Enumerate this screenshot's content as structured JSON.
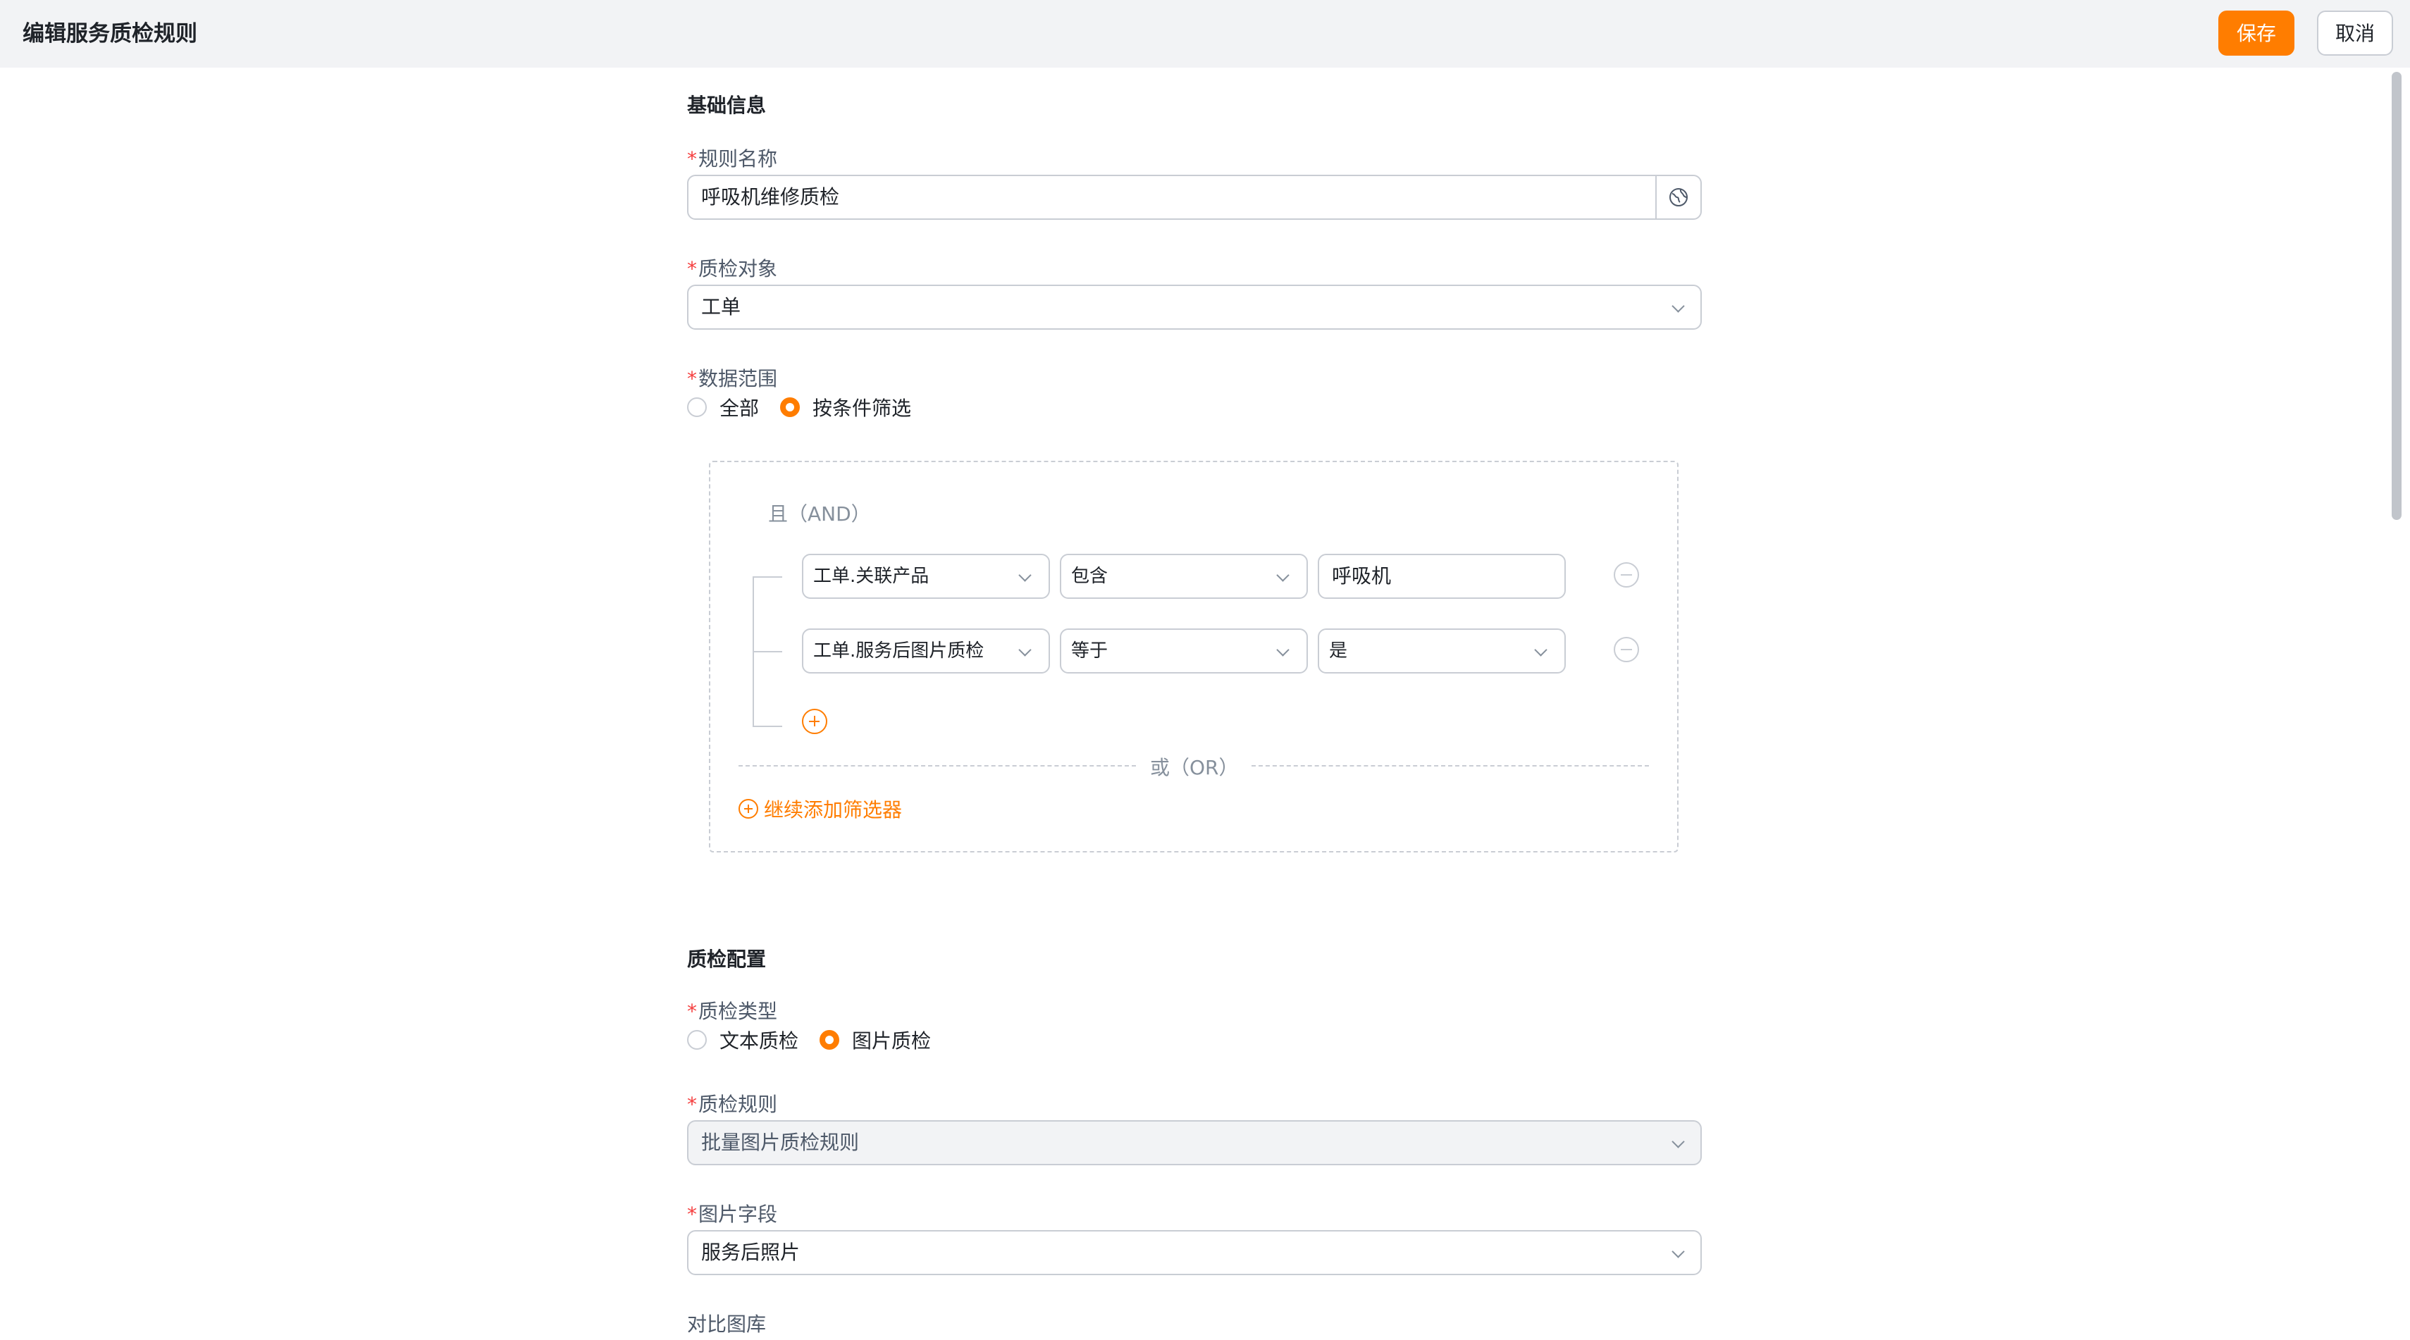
{
  "header": {
    "title": "编辑服务质检规则",
    "save_label": "保存",
    "cancel_label": "取消"
  },
  "basic": {
    "section_title": "基础信息",
    "rule_name": {
      "required_mark": "*",
      "label": "规则名称",
      "value": "呼吸机维修质检",
      "suffix_icon": "globe-icon"
    },
    "qc_object": {
      "required_mark": "*",
      "label": "质检对象",
      "value": "工单"
    },
    "data_range": {
      "required_mark": "*",
      "label": "数据范围",
      "options": [
        "全部",
        "按条件筛选"
      ],
      "selected": "按条件筛选"
    }
  },
  "filter": {
    "and_label": "且（AND）",
    "or_label": "或（OR）",
    "conditions": [
      {
        "field": "工单.关联产品",
        "operator": "包含",
        "value": "呼吸机"
      },
      {
        "field": "工单.服务后图片质检",
        "operator": "等于",
        "value": "是"
      }
    ],
    "add_filter_label": "继续添加筛选器"
  },
  "config": {
    "section_title": "质检配置",
    "qc_type": {
      "required_mark": "*",
      "label": "质检类型",
      "options": [
        "文本质检",
        "图片质检"
      ],
      "selected": "图片质检"
    },
    "qc_rule": {
      "required_mark": "*",
      "label": "质检规则",
      "value": "批量图片质检规则"
    },
    "image_field": {
      "required_mark": "*",
      "label": "图片字段",
      "value": "服务后照片"
    },
    "compare_gallery": {
      "label": "对比图库"
    }
  },
  "colors": {
    "accent": "#ff7d00",
    "required": "#f53f3f",
    "border": "#c9cdd4",
    "header_bg": "#f2f3f5"
  }
}
